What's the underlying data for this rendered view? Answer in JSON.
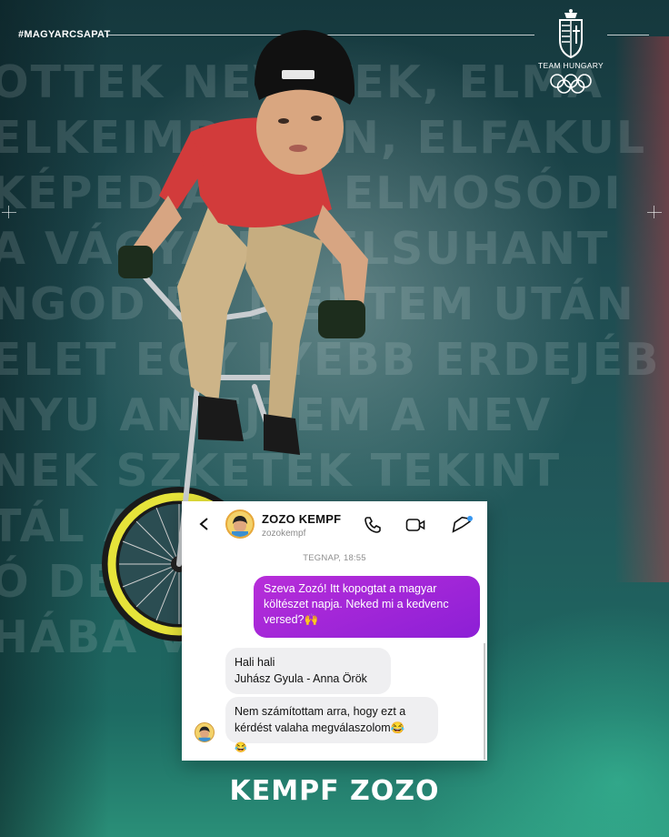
{
  "hashtag": "#MAGYARCSAPAT",
  "team": {
    "name": "TEAM HUNGARY"
  },
  "background_poem": [
    "OTTEK  NEVETEK, ELMA",
    "ELKEIMB  SSAN, ELFAKUL",
    "KÉPED  A  EN, ELMOSÓDI",
    "A VÁGYAIDA  ELSUHANT",
    "NGOD ÉS  MENTEM UTÁN",
    "ELET EGY  LYEBB ERDEJÉB",
    "NYU  AN EJTEM A NEV",
    "NEK  SZKETEK TEKINT",
    "  TÁL A SO",
    "  Ó DE MÉG",
    "  HÁBA VO"
  ],
  "chat": {
    "name": "ZOZO KEMPF",
    "handle": "zozokempf",
    "timestamp": "TEGNAP, 18:55",
    "outgoing_message": "Szeva Zozó! Itt kopogtat a magyar költészet napja. Neked mi a kedvenc versed?🙌",
    "incoming_message_1_line1": "Hali hali",
    "incoming_message_1_line2": "Juhász Gyula - Anna Örök",
    "incoming_message_2": "Nem számítottam arra, hogy ezt a kérdést valaha megválaszolom😂",
    "reaction": "😂"
  },
  "footer_name": "KEMPF ZOZO",
  "colors": {
    "bubble_purple": "#9d25d8",
    "bubble_grey": "#efeff1",
    "background_teal": "#21585a",
    "notification_dot": "#3797f0"
  },
  "icons": [
    "back-chevron-icon",
    "phone-icon",
    "video-camera-icon",
    "tag-icon",
    "coat-of-arms-icon",
    "olympic-rings-icon"
  ]
}
